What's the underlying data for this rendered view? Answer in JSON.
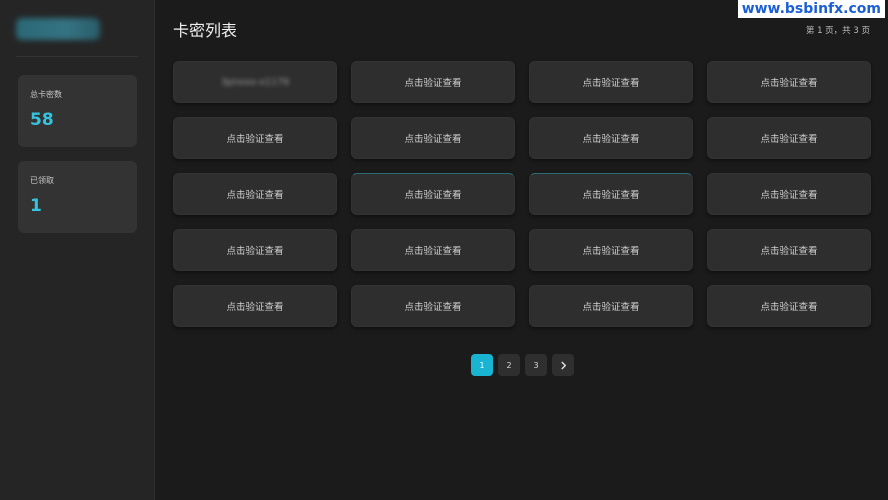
{
  "watermark": "www.bsbinfx.com",
  "sidebar": {
    "stats": [
      {
        "label": "总卡密数",
        "value": "58"
      },
      {
        "label": "已领取",
        "value": "1"
      }
    ]
  },
  "main": {
    "title": "卡密列表",
    "page_info": "第 1 页，共 3 页",
    "cards": [
      {
        "label": "3pnxxx-x1179",
        "revealed": true
      },
      {
        "label": "点击验证查看"
      },
      {
        "label": "点击验证查看"
      },
      {
        "label": "点击验证查看"
      },
      {
        "label": "点击验证查看"
      },
      {
        "label": "点击验证查看"
      },
      {
        "label": "点击验证查看"
      },
      {
        "label": "点击验证查看"
      },
      {
        "label": "点击验证查看"
      },
      {
        "label": "点击验证查看"
      },
      {
        "label": "点击验证查看"
      },
      {
        "label": "点击验证查看"
      },
      {
        "label": "点击验证查看"
      },
      {
        "label": "点击验证查看"
      },
      {
        "label": "点击验证查看"
      },
      {
        "label": "点击验证查看"
      },
      {
        "label": "点击验证查看"
      },
      {
        "label": "点击验证查看"
      },
      {
        "label": "点击验证查看"
      },
      {
        "label": "点击验证查看"
      }
    ]
  },
  "pagination": {
    "pages": [
      "1",
      "2",
      "3"
    ],
    "current": "1",
    "next_icon": "chevron-right-icon"
  },
  "colors": {
    "accent": "#18b4d2",
    "stat_value": "#35c4df",
    "background": "#1b1b1b",
    "sidebar": "#252525",
    "card": "#2e2e2e"
  }
}
